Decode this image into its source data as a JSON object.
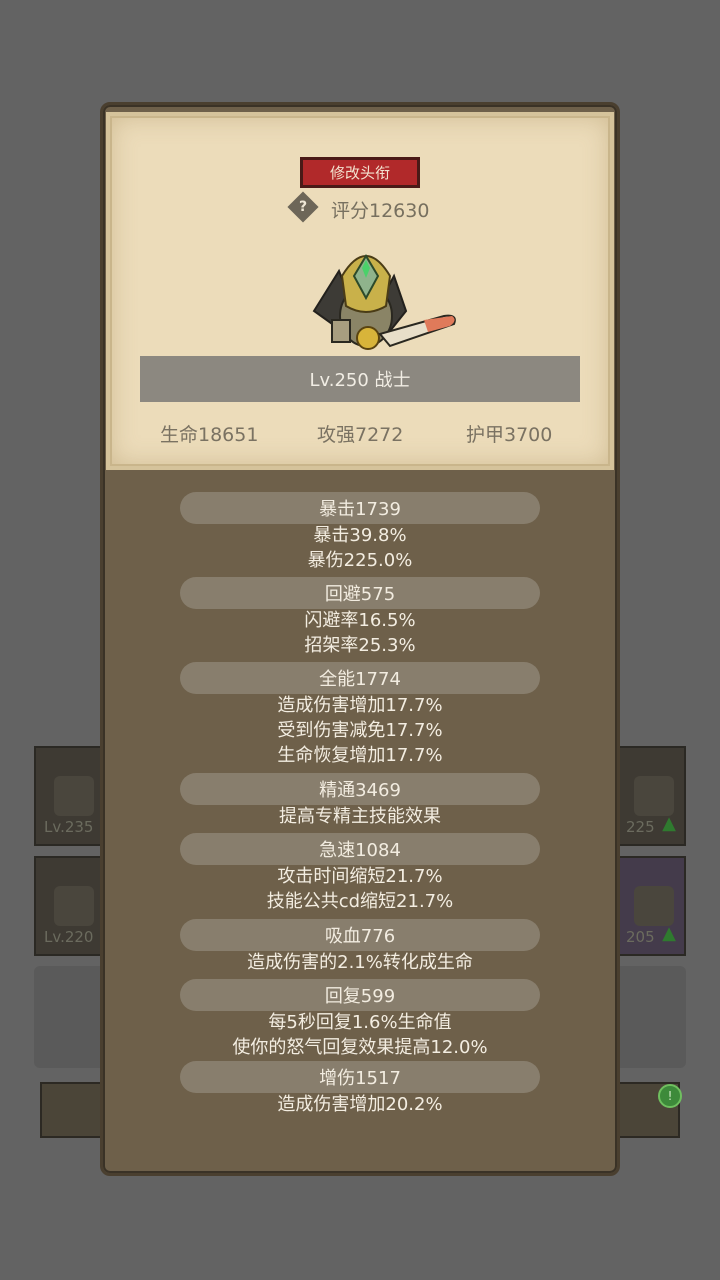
{
  "background": {
    "slots": [
      {
        "level": "Lv.235"
      },
      {
        "level": "Lv.220"
      },
      {
        "level": "225"
      },
      {
        "level": "205"
      }
    ]
  },
  "card": {
    "rename_button": "修改头衔",
    "help_icon": "?",
    "score": "评分12630",
    "level_class": "Lv.250 战士",
    "hp": "生命18651",
    "attack": "攻强7272",
    "armor": "护甲3700"
  },
  "stats": [
    {
      "header": "暴击1739",
      "lines": [
        "暴击39.8%",
        "暴伤225.0%"
      ]
    },
    {
      "header": "回避575",
      "lines": [
        "闪避率16.5%",
        "招架率25.3%"
      ]
    },
    {
      "header": "全能1774",
      "lines": [
        "造成伤害增加17.7%",
        "受到伤害减免17.7%",
        "生命恢复增加17.7%"
      ]
    },
    {
      "header": "精通3469",
      "lines": [
        "提高专精主技能效果"
      ]
    },
    {
      "header": "急速1084",
      "lines": [
        "攻击时间缩短21.7%",
        "技能公共cd缩短21.7%"
      ]
    },
    {
      "header": "吸血776",
      "lines": [
        "造成伤害的2.1%转化成生命"
      ]
    },
    {
      "header": "回复599",
      "lines": [
        "每5秒回复1.6%生命值",
        "使你的怒气回复效果提高12.0%"
      ]
    },
    {
      "header": "增伤1517",
      "lines": [
        "造成伤害增加20.2%"
      ]
    }
  ],
  "colors": {
    "popup": "#6e604a",
    "card": "#ecdcba",
    "rename_button": "#b1292a",
    "stat_header": "#887e6d"
  }
}
